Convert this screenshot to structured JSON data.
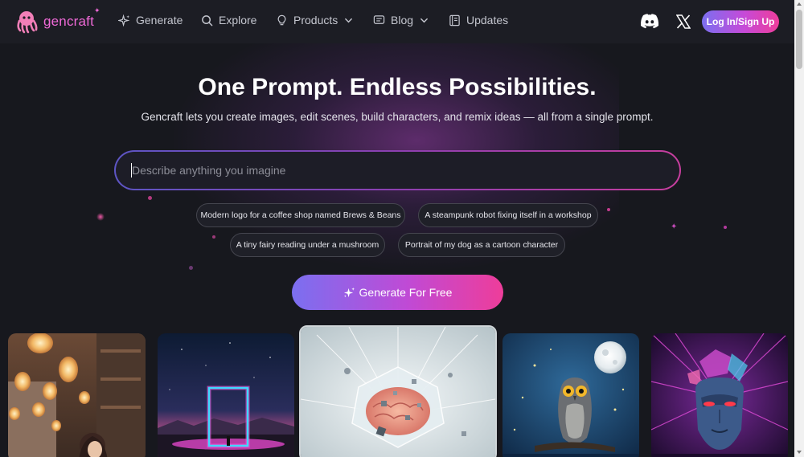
{
  "nav": {
    "logo_text": "gencraft",
    "items": [
      {
        "label": "Generate",
        "icon": "sparkles-icon"
      },
      {
        "label": "Explore",
        "icon": "search-icon"
      },
      {
        "label": "Products",
        "icon": "lightbulb-icon",
        "dropdown": true
      },
      {
        "label": "Blog",
        "icon": "chat-icon",
        "dropdown": true
      },
      {
        "label": "Updates",
        "icon": "book-icon"
      }
    ],
    "discord_icon": "discord-icon",
    "x_icon": "x-icon",
    "login_label": "Log In/Sign Up"
  },
  "hero": {
    "title": "One Prompt. Endless Possibilities.",
    "subtitle": "Gencraft lets you create images, edit scenes, build characters, and remix ideas — all from a single prompt."
  },
  "prompt": {
    "placeholder": "Describe anything you imagine",
    "value": ""
  },
  "suggestions": [
    "Modern logo for a coffee shop named Brews & Beans",
    "A steampunk robot fixing itself in a workshop",
    "A tiny fairy reading under a mushroom",
    "Portrait of my dog as a cartoon character"
  ],
  "cta": {
    "label": "Generate For Free",
    "icon": "sparkles-icon"
  },
  "gallery": [
    {
      "name": "lantern-cafe-girl"
    },
    {
      "name": "neon-portal-desert"
    },
    {
      "name": "crystal-brain"
    },
    {
      "name": "owl-moon-night"
    },
    {
      "name": "cyberpunk-face"
    }
  ],
  "colors": {
    "background": "#17181e",
    "nav": "#1c1d24",
    "accent_purple": "#7b6ff0",
    "accent_pink": "#ee3d9a",
    "logo_pink": "#f06ad8"
  }
}
